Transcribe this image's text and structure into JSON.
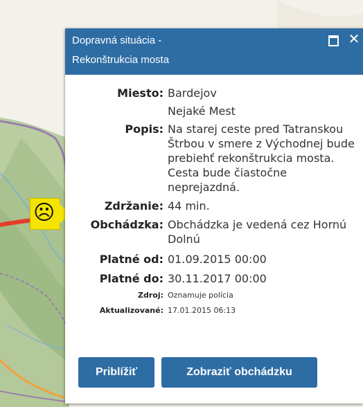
{
  "popup": {
    "title_line1": "Dopravná situácia -",
    "title_line2": "Rekonštrukcia mosta",
    "maximize_icon": "maximize-icon",
    "close_icon": "close-icon",
    "close_glyph": "✕"
  },
  "details": {
    "miesto_label": "Miesto:",
    "miesto_value1": "Bardejov",
    "miesto_value2": "Nejaké Mest",
    "popis_label": "Popis:",
    "popis_value": "Na starej ceste pred Tatranskou Štrbou v smere z Východnej bude prebiehť rekonštrukcia mosta. Cesta bude čiastočne neprejazdná.",
    "zdrzanie_label": "Zdržanie:",
    "zdrzanie_value": "44 min.",
    "obchadzka_label": "Obchádzka:",
    "obchadzka_value": "Obchádzka je vedená cez Hornú Dolnú",
    "platne_od_label": "Platné od:",
    "platne_od_value": "01.09.2015 00:00",
    "platne_do_label": "Platné do:",
    "platne_do_value": "30.11.2017 00:00",
    "zdroj_label": "Zdroj:",
    "zdroj_value": "Oznamuje polícia",
    "aktualizovane_label": "Aktualizované:",
    "aktualizovane_value": "17.01.2015 06:13"
  },
  "buttons": {
    "priblizit": "Priblížiť",
    "zobrazit_obchadzku": "Zobraziť obchádzku"
  },
  "marker": {
    "icon": "sad-face-icon",
    "glyph": "☹",
    "color": "#f5e400"
  },
  "colors": {
    "header": "#2e6da4",
    "button": "#2e6da4"
  }
}
